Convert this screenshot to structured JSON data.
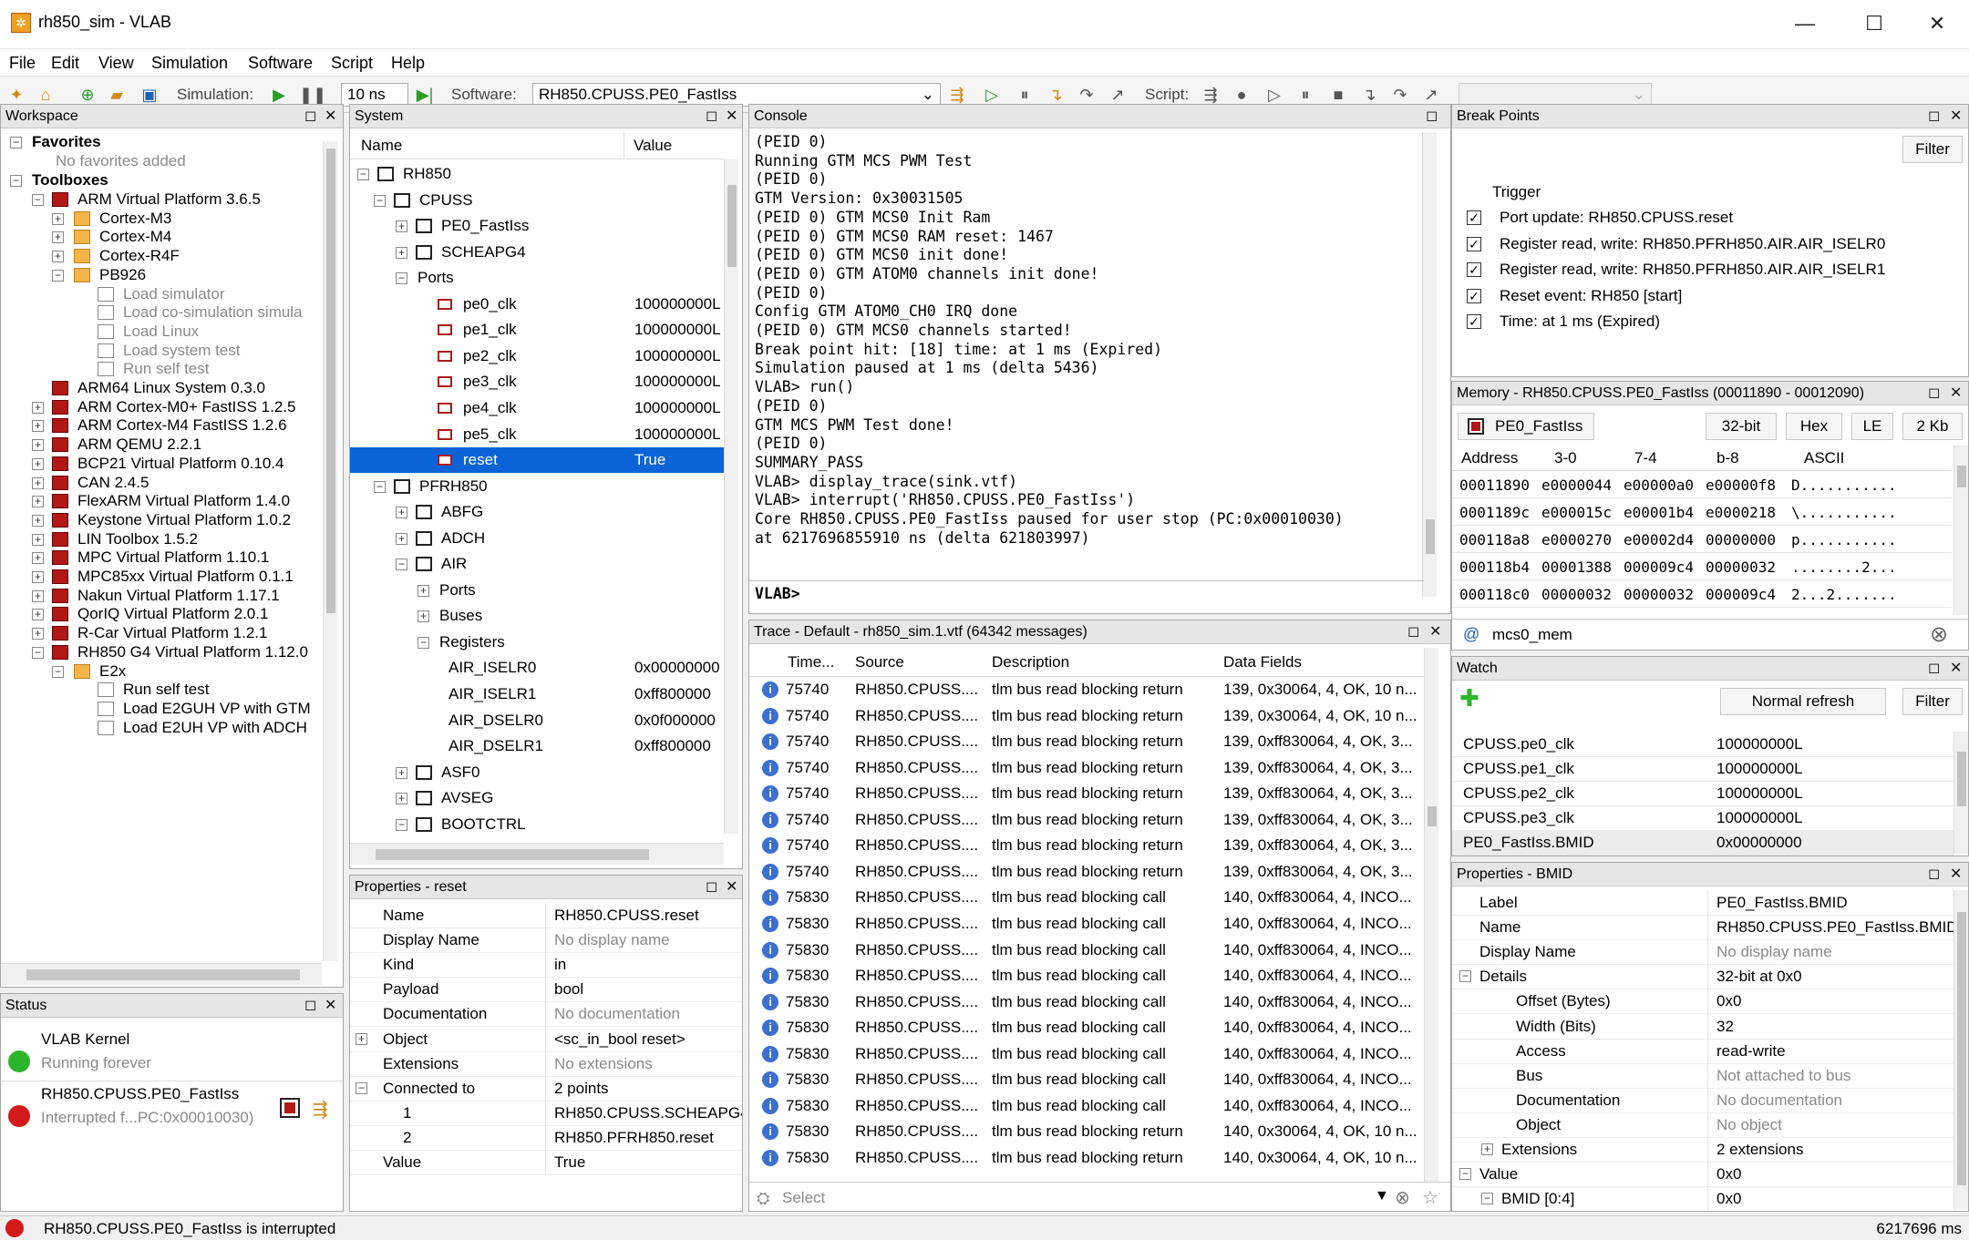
{
  "window": {
    "title": "rh850_sim - VLAB",
    "min": "—",
    "max": "☐",
    "close": "✕"
  },
  "menu": [
    "File",
    "Edit",
    "View",
    "Simulation",
    "Software",
    "Script",
    "Help"
  ],
  "toolbar": {
    "simulation_label": "Simulation:",
    "step_value": "10 ns",
    "software_label": "Software:",
    "software_value": "RH850.CPUSS.PE0_FastIss",
    "script_label": "Script:"
  },
  "workspace": {
    "title": "Workspace",
    "favorites": "Favorites",
    "no_favorites": "No favorites added",
    "toolboxes": "Toolboxes",
    "items": [
      "ARM Virtual Platform 3.6.5",
      "Cortex-M3",
      "Cortex-M4",
      "Cortex-R4F",
      "PB926",
      "Load simulator",
      "Load co-simulation simula",
      "Load Linux",
      "Load system test",
      "Run self test",
      "ARM64 Linux System 0.3.0",
      "ARM Cortex-M0+ FastISS 1.2.5",
      "ARM Cortex-M4 FastISS 1.2.6",
      "ARM QEMU 2.2.1",
      "BCP21 Virtual Platform 0.10.4",
      "CAN 2.4.5",
      "FlexARM Virtual Platform 1.4.0",
      "Keystone Virtual Platform 1.0.2",
      "LIN Toolbox 1.5.2",
      "MPC Virtual Platform 1.10.1",
      "MPC85xx Virtual Platform 0.1.1",
      "Nakun Virtual Platform 1.17.1",
      "QorIQ Virtual Platform 2.0.1",
      "R-Car Virtual Platform 1.2.1",
      "RH850 G4 Virtual Platform 1.12.0",
      "E2x",
      "Run self test",
      "Load E2GUH VP with GTM",
      "Load E2UH VP with ADCH"
    ]
  },
  "status": {
    "title": "Status",
    "kernel": "VLAB Kernel",
    "kernel_state": "Running forever",
    "core": "RH850.CPUSS.PE0_FastIss",
    "core_state": "Interrupted f...PC:0x00010030)"
  },
  "system": {
    "title": "System",
    "col_name": "Name",
    "col_value": "Value",
    "rows": [
      [
        "RH850",
        ""
      ],
      [
        "CPUSS",
        ""
      ],
      [
        "PE0_FastIss",
        ""
      ],
      [
        "SCHEAPG4",
        ""
      ],
      [
        "Ports",
        ""
      ],
      [
        "pe0_clk",
        "100000000L"
      ],
      [
        "pe1_clk",
        "100000000L"
      ],
      [
        "pe2_clk",
        "100000000L"
      ],
      [
        "pe3_clk",
        "100000000L"
      ],
      [
        "pe4_clk",
        "100000000L"
      ],
      [
        "pe5_clk",
        "100000000L"
      ],
      [
        "reset",
        "True"
      ],
      [
        "PFRH850",
        ""
      ],
      [
        "ABFG",
        ""
      ],
      [
        "ADCH",
        ""
      ],
      [
        "AIR",
        ""
      ],
      [
        "Ports",
        ""
      ],
      [
        "Buses",
        ""
      ],
      [
        "Registers",
        ""
      ],
      [
        "AIR_ISELR0",
        "0x00000000"
      ],
      [
        "AIR_ISELR1",
        "0xff800000"
      ],
      [
        "AIR_DSELR0",
        "0x0f000000"
      ],
      [
        "AIR_DSELR1",
        "0xff800000"
      ],
      [
        "ASF0",
        ""
      ],
      [
        "AVSEG",
        ""
      ],
      [
        "BOOTCTRL",
        ""
      ]
    ]
  },
  "props_reset": {
    "title": "Properties - reset",
    "rows": [
      [
        "Name",
        "RH850.CPUSS.reset"
      ],
      [
        "Display Name",
        "No display name"
      ],
      [
        "Kind",
        "in"
      ],
      [
        "Payload",
        "bool"
      ],
      [
        "Documentation",
        "No documentation"
      ],
      [
        "Object",
        "<sc_in_bool reset>"
      ],
      [
        "Extensions",
        "No extensions"
      ],
      [
        "Connected to",
        "2 points"
      ],
      [
        "1",
        "RH850.CPUSS.SCHEAPG4.r"
      ],
      [
        "2",
        "RH850.PFRH850.reset"
      ],
      [
        "Value",
        "True"
      ]
    ]
  },
  "console": {
    "title": "Console",
    "prompt": "VLAB>",
    "lines": [
      "(PEID 0)",
      "Running GTM MCS PWM Test",
      "(PEID 0)",
      "GTM Version: 0x30031505",
      "(PEID 0) GTM MCS0 Init Ram",
      "(PEID 0) GTM MCS0 RAM reset: 1467",
      "(PEID 0) GTM MCS0 init done!",
      "(PEID 0) GTM ATOM0 channels init done!",
      "(PEID 0)",
      "Config GTM ATOM0_CH0 IRQ done",
      "(PEID 0) GTM MCS0 channels started!",
      "Break point hit: [18] time: at 1 ms (Expired)",
      "Simulation paused at 1 ms (delta 5436)",
      "VLAB> run()",
      "(PEID 0)",
      "GTM MCS PWM Test done!",
      "(PEID 0)",
      "SUMMARY_PASS",
      "VLAB> display_trace(sink.vtf)",
      "VLAB> interrupt('RH850.CPUSS.PE0_FastIss')",
      "Core RH850.CPUSS.PE0_FastIss paused for user stop (PC:0x00010030)",
      "at 6217696855910 ns (delta 621803997)"
    ]
  },
  "trace": {
    "title": "Trace - Default - rh850_sim.1.vtf (64342 messages)",
    "cols": [
      "Time...",
      "Source",
      "Description",
      "Data Fields"
    ],
    "select": "Select",
    "rows": [
      [
        "75740",
        "RH850.CPUSS....",
        "tlm bus read blocking return",
        "139, 0x30064, 4, OK, 10 n..."
      ],
      [
        "75740",
        "RH850.CPUSS....",
        "tlm bus read blocking return",
        "139, 0x30064, 4, OK, 10 n..."
      ],
      [
        "75740",
        "RH850.CPUSS....",
        "tlm bus read blocking return",
        "139, 0xff830064, 4, OK, 3..."
      ],
      [
        "75740",
        "RH850.CPUSS....",
        "tlm bus read blocking return",
        "139, 0xff830064, 4, OK, 3..."
      ],
      [
        "75740",
        "RH850.CPUSS....",
        "tlm bus read blocking return",
        "139, 0xff830064, 4, OK, 3..."
      ],
      [
        "75740",
        "RH850.CPUSS....",
        "tlm bus read blocking return",
        "139, 0xff830064, 4, OK, 3..."
      ],
      [
        "75740",
        "RH850.CPUSS....",
        "tlm bus read blocking return",
        "139, 0xff830064, 4, OK, 3..."
      ],
      [
        "75740",
        "RH850.CPUSS....",
        "tlm bus read blocking return",
        "139, 0xff830064, 4, OK, 3..."
      ],
      [
        "75830",
        "RH850.CPUSS....",
        "tlm bus read blocking call",
        "140, 0xff830064, 4, INCO..."
      ],
      [
        "75830",
        "RH850.CPUSS....",
        "tlm bus read blocking call",
        "140, 0xff830064, 4, INCO..."
      ],
      [
        "75830",
        "RH850.CPUSS....",
        "tlm bus read blocking call",
        "140, 0xff830064, 4, INCO..."
      ],
      [
        "75830",
        "RH850.CPUSS....",
        "tlm bus read blocking call",
        "140, 0xff830064, 4, INCO..."
      ],
      [
        "75830",
        "RH850.CPUSS....",
        "tlm bus read blocking call",
        "140, 0xff830064, 4, INCO..."
      ],
      [
        "75830",
        "RH850.CPUSS....",
        "tlm bus read blocking call",
        "140, 0xff830064, 4, INCO..."
      ],
      [
        "75830",
        "RH850.CPUSS....",
        "tlm bus read blocking call",
        "140, 0xff830064, 4, INCO..."
      ],
      [
        "75830",
        "RH850.CPUSS....",
        "tlm bus read blocking call",
        "140, 0xff830064, 4, INCO..."
      ],
      [
        "75830",
        "RH850.CPUSS....",
        "tlm bus read blocking call",
        "140, 0xff830064, 4, INCO..."
      ],
      [
        "75830",
        "RH850.CPUSS....",
        "tlm bus read blocking return",
        "140, 0x30064, 4, OK, 10 n..."
      ],
      [
        "75830",
        "RH850.CPUSS....",
        "tlm bus read blocking return",
        "140, 0x30064, 4, OK, 10 n..."
      ]
    ]
  },
  "breakpoints": {
    "title": "Break Points",
    "filter": "Filter",
    "col": "Trigger",
    "rows": [
      "Port update: RH850.CPUSS.reset",
      "Register read, write: RH850.PFRH850.AIR.AIR_ISELR0",
      "Register read, write: RH850.PFRH850.AIR.AIR_ISELR1",
      "Reset event: RH850 [start]",
      "Time: at 1 ms (Expired)"
    ]
  },
  "memory": {
    "title": "Memory - RH850.CPUSS.PE0_FastIss (00011890 - 00012090)",
    "target": "PE0_FastIss",
    "bits": "32-bit",
    "fmt": "Hex",
    "endian": "LE",
    "size": "2 Kb",
    "cols": [
      "Address",
      "3-0",
      "7-4",
      "b-8",
      "ASCII"
    ],
    "search": "mcs0_mem",
    "rows": [
      [
        "00011890",
        "e0000044",
        "e00000a0",
        "e00000f8",
        "D..........."
      ],
      [
        "0001189c",
        "e000015c",
        "e00001b4",
        "e0000218",
        "\\..........."
      ],
      [
        "000118a8",
        "e0000270",
        "e00002d4",
        "00000000",
        "p..........."
      ],
      [
        "000118b4",
        "00001388",
        "000009c4",
        "00000032",
        "........2..."
      ],
      [
        "000118c0",
        "00000032",
        "00000032",
        "000009c4",
        "2...2......."
      ]
    ]
  },
  "watch": {
    "title": "Watch",
    "refresh": "Normal refresh",
    "filter": "Filter",
    "rows": [
      [
        "CPUSS.pe0_clk",
        "100000000L"
      ],
      [
        "CPUSS.pe1_clk",
        "100000000L"
      ],
      [
        "CPUSS.pe2_clk",
        "100000000L"
      ],
      [
        "CPUSS.pe3_clk",
        "100000000L"
      ],
      [
        "PE0_FastIss.BMID",
        "0x00000000"
      ]
    ]
  },
  "props_bmid": {
    "title": "Properties - BMID",
    "rows": [
      [
        "Label",
        "PE0_FastIss.BMID"
      ],
      [
        "Name",
        "RH850.CPUSS.PE0_FastIss.BMID"
      ],
      [
        "Display Name",
        "No display name"
      ],
      [
        "Details",
        "32-bit at 0x0"
      ],
      [
        "Offset (Bytes)",
        "0x0"
      ],
      [
        "Width (Bits)",
        "32"
      ],
      [
        "Access",
        "read-write"
      ],
      [
        "Bus",
        "Not attached to bus"
      ],
      [
        "Documentation",
        "No documentation"
      ],
      [
        "Object",
        "No object"
      ],
      [
        "Extensions",
        "2 extensions"
      ],
      [
        "Value",
        "0x0"
      ],
      [
        "BMID [0:4]",
        "0x0"
      ]
    ]
  },
  "statusbar": {
    "message": "RH850.CPUSS.PE0_FastIss is interrupted",
    "time": "6217696 ms"
  }
}
